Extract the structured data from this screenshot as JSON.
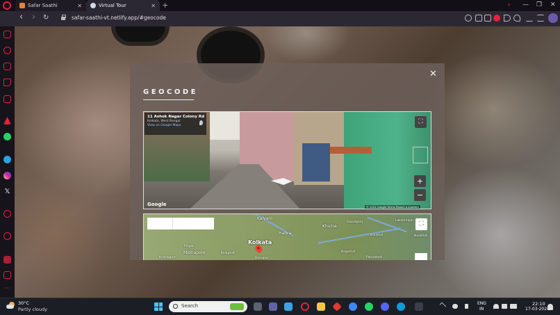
{
  "browser": {
    "tabs": [
      {
        "label": "Safar Saathi",
        "favicon_color": "#e8833a",
        "active": false
      },
      {
        "label": "Virtual Tour",
        "favicon_color": "#cfd8e0",
        "active": true
      }
    ],
    "new_tab_symbol": "+",
    "close_symbol": "✕",
    "url": "safar-saathi-vt.netlify.app/#geocode",
    "nav_back": "‹",
    "nav_forward": "›",
    "nav_reload": "↻",
    "window_controls": {
      "search": "⌕",
      "minimize": "—",
      "restore": "❐",
      "close": "✕"
    }
  },
  "sidebar": {
    "items": [
      {
        "name": "aria",
        "color": "#e0233c"
      },
      {
        "name": "gaming",
        "color": "#e0233c"
      },
      {
        "name": "history",
        "color": "#e0233c"
      },
      {
        "name": "shopping",
        "color": "#e0233c"
      },
      {
        "name": "twitch",
        "color": "#e0233c"
      },
      {
        "name": "instagram-alt",
        "color": "#e0233c"
      },
      {
        "name": "arc",
        "color": "#e0233c"
      },
      {
        "name": "whatsapp",
        "color": "#25d366"
      },
      {
        "name": "telegram",
        "color": "#2aa3e0"
      },
      {
        "name": "instagram",
        "color": "#d6249f"
      },
      {
        "name": "x",
        "color": "#ffffff"
      },
      {
        "name": "settings",
        "color": "#e0233c"
      },
      {
        "name": "clock",
        "color": "#e0233c"
      },
      {
        "name": "extension",
        "color": "#e0233c"
      },
      {
        "name": "wallet",
        "color": "#e0233c"
      },
      {
        "name": "more",
        "color": "#e0233c"
      }
    ]
  },
  "modal": {
    "title": "GEOCODE",
    "close_symbol": "✕",
    "street_view": {
      "address": "11 Ashok Nagar Colony Rd",
      "city": "Kolkata, West Bengal",
      "view_link": "View on Google Maps",
      "google": "Google",
      "attribution": "© 2024 Google   Terms   Report a problem",
      "fullscreen_symbol": "⛶",
      "zoom_in": "+",
      "zoom_out": "−"
    },
    "map": {
      "labels": [
        "Kalyani",
        "Habra",
        "Khulna",
        "Gopalganj",
        "Lakshmipur",
        "Barishal",
        "Noakhali",
        "Kolkata",
        "Midnapore",
        "Kolaghat",
        "Bagerhat",
        "Patuakhali",
        "Baruipur",
        "Pingla",
        "Kharagpur"
      ],
      "fullscreen_symbol": "⛶"
    }
  },
  "taskbar": {
    "temperature": "30°C",
    "condition": "Partly cloudy",
    "search_placeholder": "Search",
    "language_line1": "ENG",
    "language_line2": "IN",
    "time": "22:10",
    "date": "17-03-2024"
  }
}
